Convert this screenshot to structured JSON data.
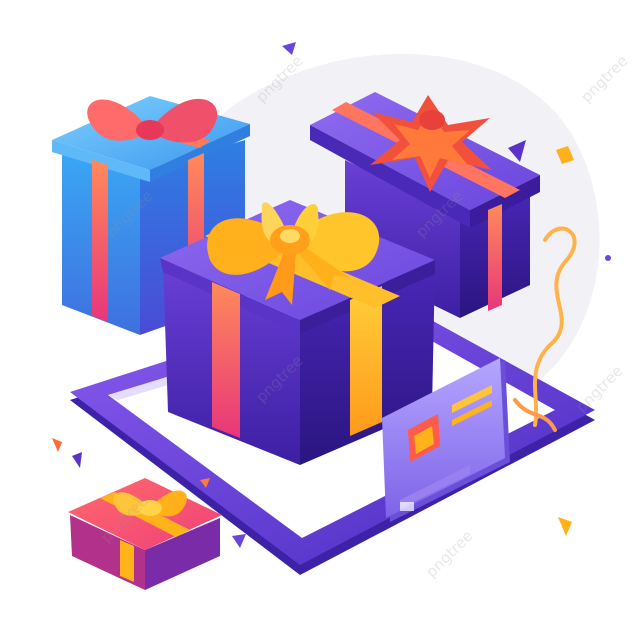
{
  "scene": {
    "subject": "isometric gift boxes on a tablet with a gift card",
    "colors": {
      "background": "#ffffff",
      "blob": "#f2f2f6",
      "purple": "#5a34c7",
      "purple_dark": "#3c1f95",
      "blue": "#3aa0f0",
      "pink": "#f0556b",
      "gold": "#ffb21a",
      "orange": "#ff7a3a"
    }
  },
  "watermark": {
    "text": "pngtree"
  }
}
